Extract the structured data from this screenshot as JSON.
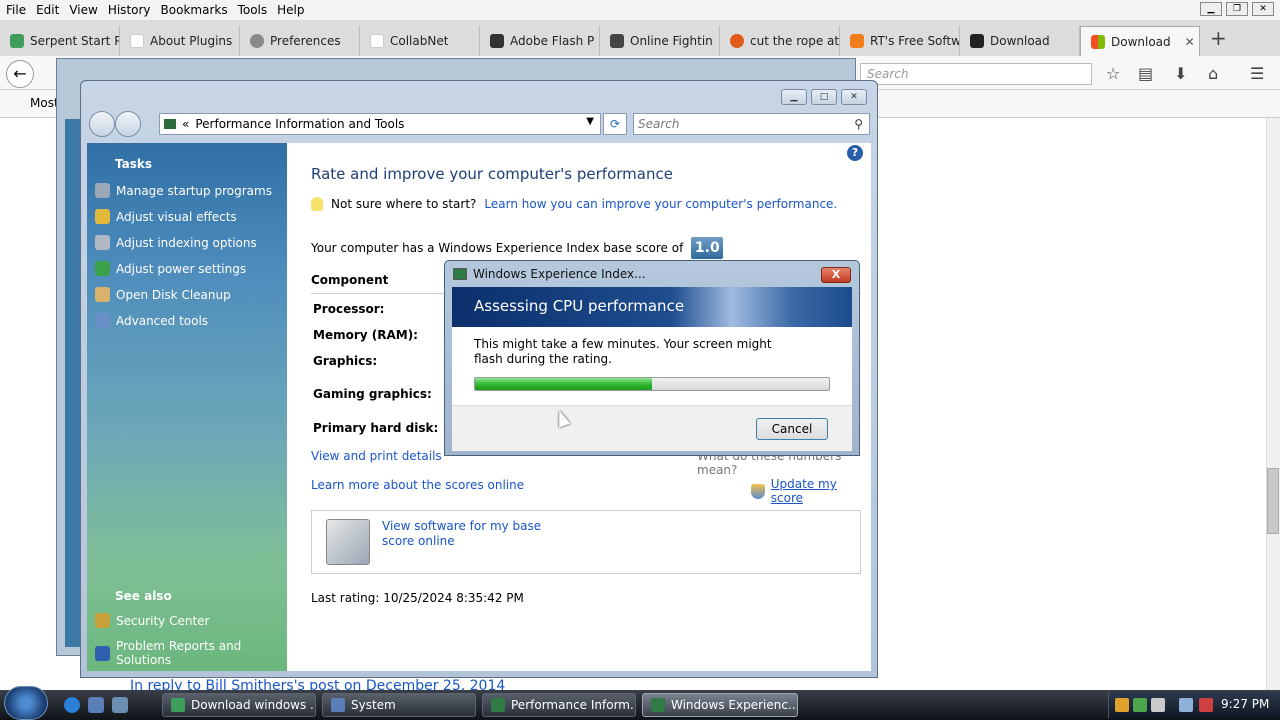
{
  "firefox": {
    "menu": [
      "File",
      "Edit",
      "View",
      "History",
      "Bookmarks",
      "Tools",
      "Help"
    ],
    "tabs": [
      {
        "label": "Serpent Start P",
        "color": "#3d9e5c"
      },
      {
        "label": "About Plugins",
        "color": "#ffffff"
      },
      {
        "label": "Preferences",
        "color": "#8a8a8a"
      },
      {
        "label": "CollabNet",
        "color": "#ffffff"
      },
      {
        "label": "Adobe Flash P",
        "color": "#333333"
      },
      {
        "label": "Online Fightin",
        "color": "#444444"
      },
      {
        "label": "cut the rope at",
        "color": "#e05a1a"
      },
      {
        "label": "RT's Free Softw",
        "color": "#f07c1a"
      },
      {
        "label": "Download",
        "color": "#222222"
      },
      {
        "label": "Download",
        "color": "#f25022"
      }
    ],
    "search_placeholder": "Search",
    "bookmark_item": "Most",
    "page_link": "In reply to Bill Smithers's post on December 25, 2014"
  },
  "vista": {
    "address": "Performance Information and Tools",
    "address_prefix": "«",
    "search_placeholder": "Search",
    "help": "?",
    "sidebar": {
      "tasks_header": "Tasks",
      "items": [
        {
          "label": "Manage startup programs",
          "color": "#9aa8b8"
        },
        {
          "label": "Adjust visual effects",
          "color": "#e2b93b"
        },
        {
          "label": "Adjust indexing options",
          "color": "#b0b8c4"
        },
        {
          "label": "Adjust power settings",
          "color": "#3aa04a"
        },
        {
          "label": "Open Disk Cleanup",
          "color": "#d9b36a"
        },
        {
          "label": "Advanced tools",
          "color": "#6a8fc7"
        }
      ],
      "see_also_header": "See also",
      "see_also": [
        {
          "label": "Security Center",
          "color": "#c9a13a"
        },
        {
          "label": "Problem Reports and Solutions",
          "color": "#2f5fb0"
        }
      ]
    },
    "title": "Rate and improve your computer's performance",
    "hint_text": "Not sure where to start?",
    "hint_link": "Learn how you can improve your computer's performance.",
    "score_text": "Your computer has a Windows Experience Index base score of",
    "score_value": "1.0",
    "table_header": "Component",
    "components": [
      "Processor:",
      "Memory (RAM):",
      "Graphics:",
      "Gaming graphics:",
      "Primary hard disk:"
    ],
    "view_print": "View and print details",
    "what_numbers": "What do these numbers mean?",
    "learn_more": "Learn more about the scores online",
    "update_score": "Update my score",
    "software_link": "View software for my base score online",
    "last_rating": "Last rating: 10/25/2024 8:35:42 PM"
  },
  "dialog": {
    "title": "Windows Experience Index...",
    "close": "X",
    "banner": "Assessing CPU performance",
    "message": "This might take a few minutes. Your screen might flash during the rating.",
    "progress": 0.5,
    "cancel": "Cancel"
  },
  "taskbar": {
    "buttons": [
      {
        "label": "Download windows ...",
        "color": "#3d9e5c"
      },
      {
        "label": "System",
        "color": "#5a7fb8"
      },
      {
        "label": "Performance Inform...",
        "color": "#2f7a45"
      },
      {
        "label": "Windows Experienc...",
        "color": "#2f7a45"
      }
    ],
    "clock": "9:27 PM"
  }
}
